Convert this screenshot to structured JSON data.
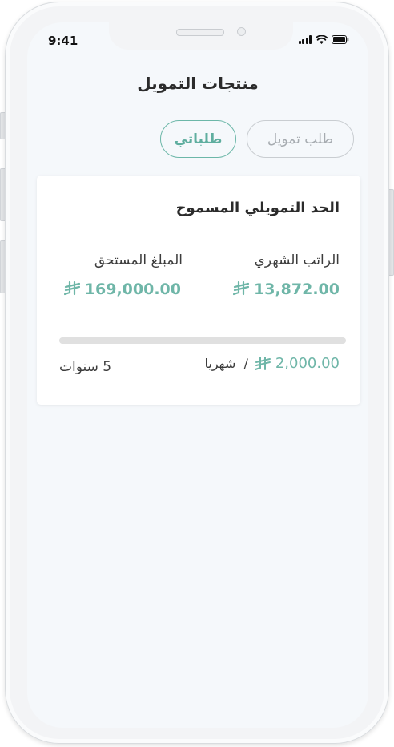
{
  "status_bar": {
    "time": "9:41"
  },
  "page": {
    "title": "منتجات التمويل"
  },
  "tabs": [
    {
      "label": "طلب تمويل",
      "active": false
    },
    {
      "label": "طلباتي",
      "active": true
    }
  ],
  "card": {
    "title": "الحد التمويلي المسموح",
    "monthly_salary": {
      "label": "الراتب الشهري",
      "value": "13,872.00"
    },
    "due_amount": {
      "label": "المبلغ المستحق",
      "value": "169,000.00"
    },
    "installment": {
      "value": "2,000.00",
      "period": "شهريا"
    },
    "duration": "5 سنوات",
    "progress": 0
  },
  "colors": {
    "accent": "#6fb6a8",
    "background": "#f5f8fb",
    "text": "#2b2b2b"
  },
  "icons": [
    "riyal-icon",
    "signal-icon",
    "wifi-icon",
    "battery-icon"
  ]
}
